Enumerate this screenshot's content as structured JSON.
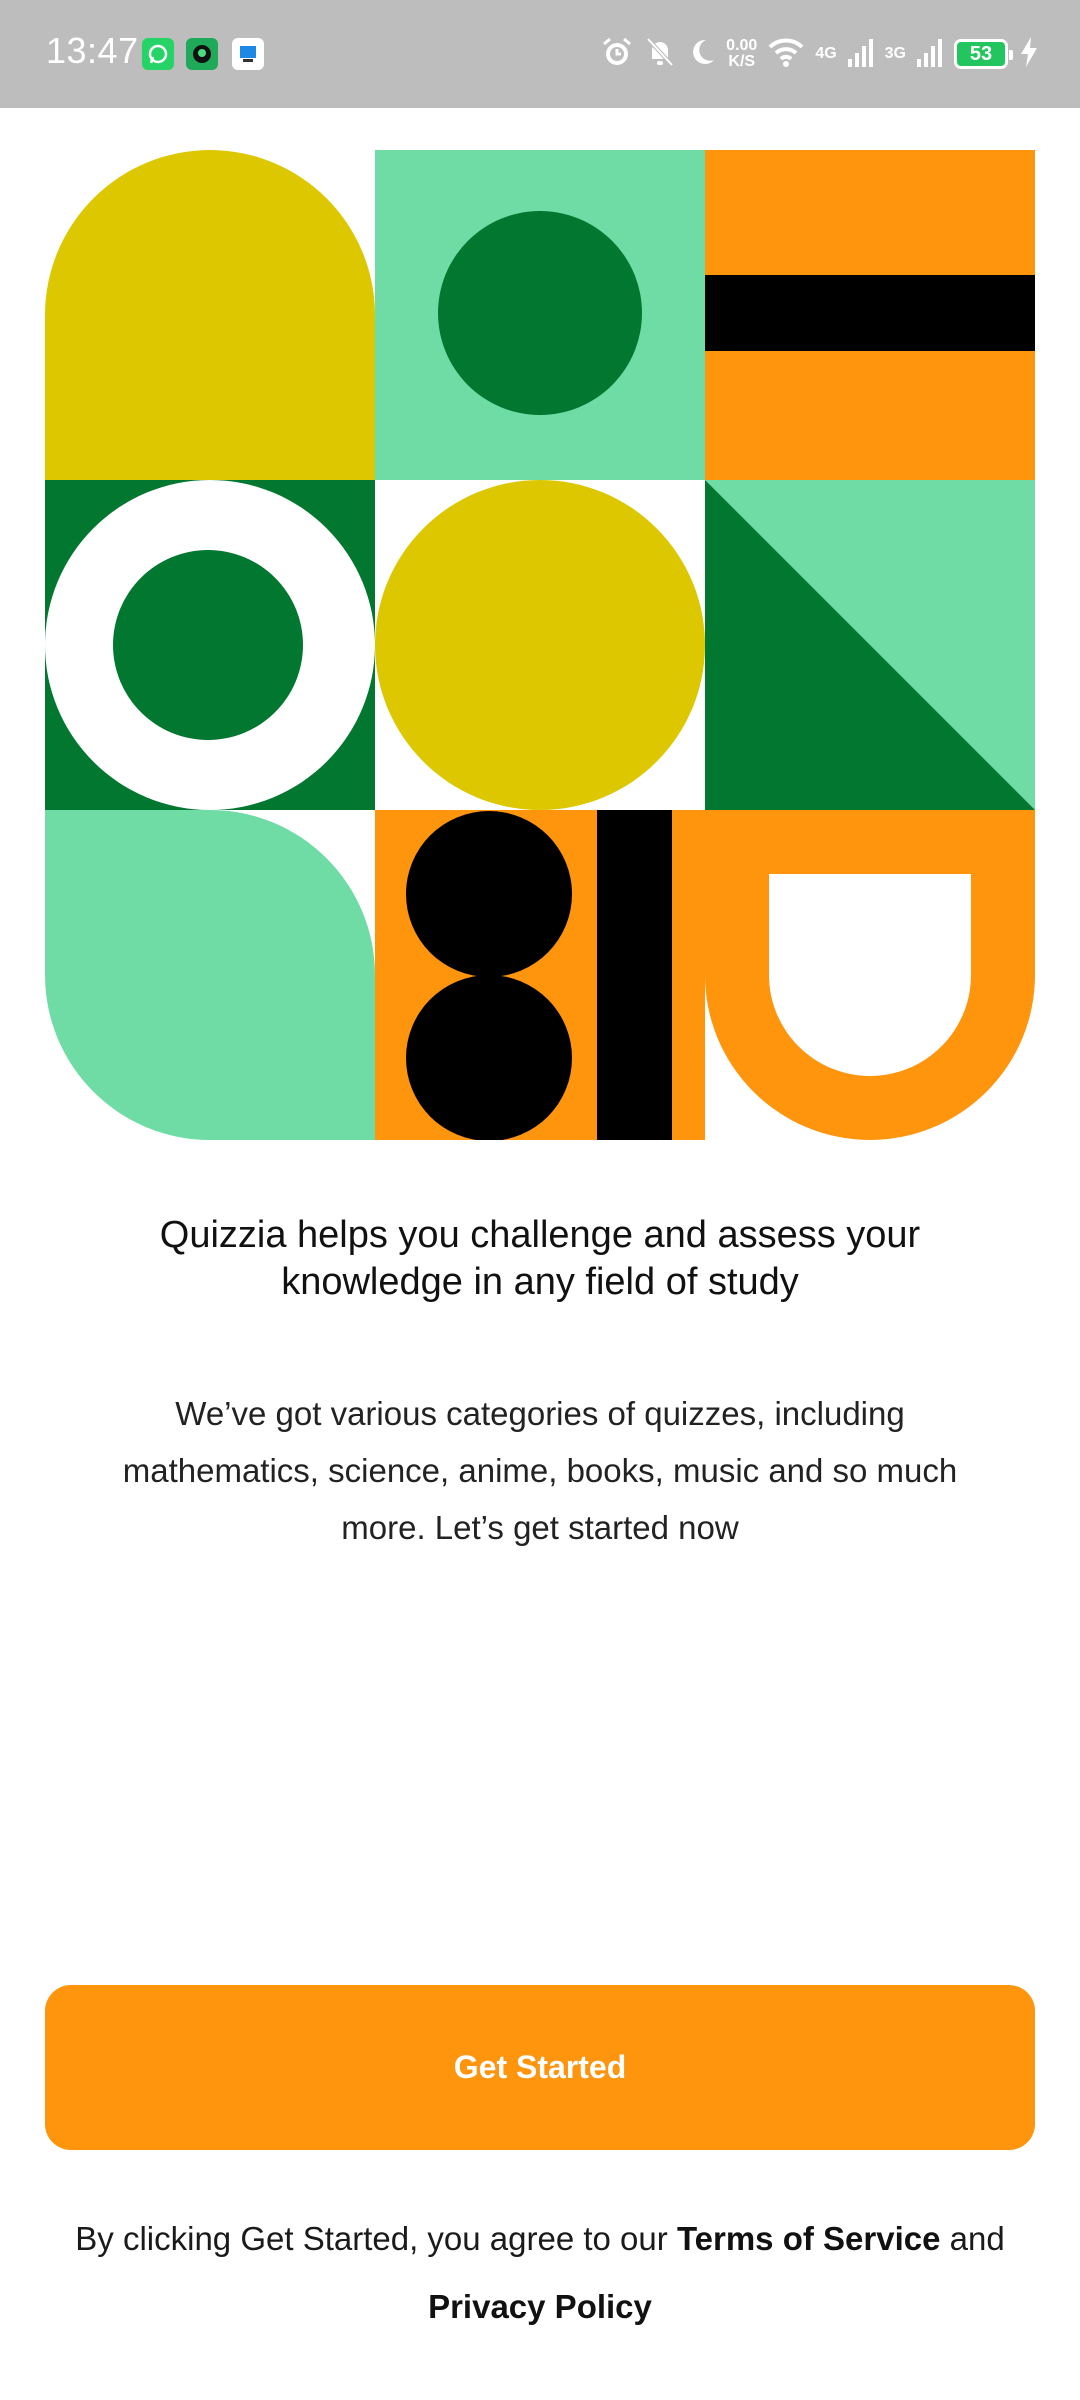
{
  "status_bar": {
    "time": "13:47",
    "notification_icons": [
      "whatsapp-icon",
      "app-icon",
      "app-icon"
    ],
    "net_speed_value": "0.00",
    "net_speed_unit": "K/S",
    "network_labels": [
      "4G",
      "3G"
    ],
    "battery": "53",
    "icons": [
      "alarm-icon",
      "muted-bell-icon",
      "moon-icon",
      "wifi-icon",
      "signal-icon",
      "charging-bolt-icon"
    ]
  },
  "colors": {
    "yellow": "#dcc700",
    "mint": "#6fdca6",
    "green": "#017730",
    "orange": "#ff940d",
    "black": "#000000",
    "white": "#ffffff"
  },
  "headline": "Quizzia helps you challenge and assess your knowledge in any field of study",
  "description": "We’ve got various categories of quizzes, including mathematics, science, anime, books, music and so much more. Let’s get started now",
  "cta": {
    "label": "Get Started"
  },
  "legal": {
    "prefix": "By clicking Get Started, you agree to our",
    "terms": "Terms of Service",
    "and": "and",
    "privacy": "Privacy Policy"
  }
}
